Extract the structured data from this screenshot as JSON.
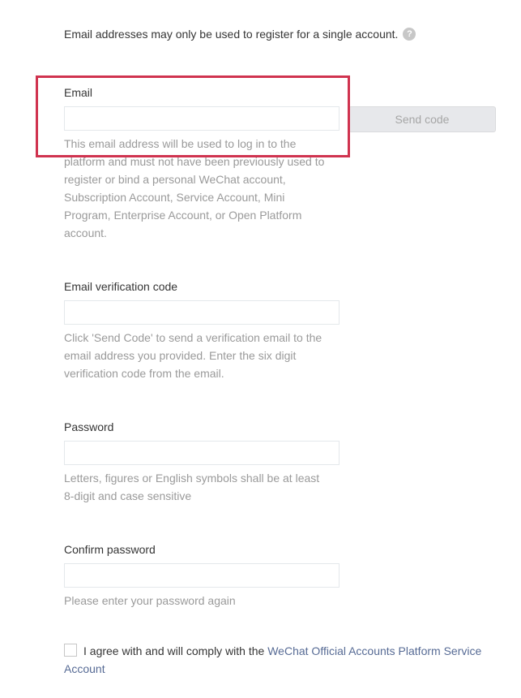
{
  "notice": {
    "text": "Email addresses may only be used to register for a single account.",
    "help_icon": "?"
  },
  "email": {
    "label": "Email",
    "value": "",
    "placeholder": "",
    "send_code_label": "Send code",
    "hint": "This email address will be used to log in to the platform and must not have been previously used to register or bind a personal WeChat account, Subscription Account, Service Account, Mini Program, Enterprise Account, or Open Platform account."
  },
  "verification": {
    "label": "Email verification code",
    "value": "",
    "hint": "Click 'Send Code' to send a verification email to the email address you provided. Enter the six digit verification code from the email."
  },
  "password": {
    "label": "Password",
    "value": "",
    "hint": "Letters, figures or English symbols shall be at least 8-digit and case sensitive"
  },
  "confirm_password": {
    "label": "Confirm password",
    "value": "",
    "hint": "Please enter your password again"
  },
  "agreement": {
    "text": "I agree with and will comply with the ",
    "link_text": "WeChat Official Accounts Platform Service Account",
    "checked": false
  },
  "colors": {
    "highlight": "#d0334f",
    "link": "#576b95",
    "hint": "#9a9a9a"
  }
}
